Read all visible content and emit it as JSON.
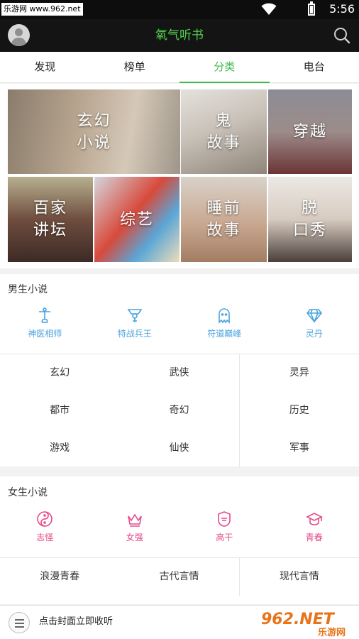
{
  "status_bar": {
    "watermark": "乐游网 www.962.net",
    "time": "5:56"
  },
  "app_bar": {
    "title": "氧气听书"
  },
  "tabs": [
    {
      "label": "发现"
    },
    {
      "label": "榜单"
    },
    {
      "label": "分类",
      "active": true
    },
    {
      "label": "电台"
    }
  ],
  "categories": [
    {
      "label": "玄幻\n小说"
    },
    {
      "label": "鬼\n故事"
    },
    {
      "label": "穿越"
    },
    {
      "label": "百家\n讲坛"
    },
    {
      "label": "综艺"
    },
    {
      "label": "睡前\n故事"
    },
    {
      "label": "脱\n口秀"
    }
  ],
  "male": {
    "title": "男生小说",
    "icon_items": [
      {
        "label": "神医相师",
        "icon": "statue-icon"
      },
      {
        "label": "特战兵王",
        "icon": "emblem-icon"
      },
      {
        "label": "符道巅峰",
        "icon": "ghost-icon"
      },
      {
        "label": "灵丹",
        "icon": "diamond-icon"
      }
    ],
    "rows": [
      [
        "玄幻",
        "武侠",
        "灵异"
      ],
      [
        "都市",
        "奇幻",
        "历史"
      ],
      [
        "游戏",
        "仙侠",
        "军事"
      ]
    ],
    "accent": "#4aa3df"
  },
  "female": {
    "title": "女生小说",
    "icon_items": [
      {
        "label": "志怪",
        "icon": "yin-yang-icon"
      },
      {
        "label": "女强",
        "icon": "crown-icon"
      },
      {
        "label": "高干",
        "icon": "badge-icon"
      },
      {
        "label": "青春",
        "icon": "graduation-cap-icon"
      }
    ],
    "rows": [
      [
        "浪漫青春",
        "古代言情",
        "现代言情"
      ]
    ],
    "accent": "#e64989"
  },
  "player": {
    "text": "点击封面立即收听"
  },
  "badge": {
    "number": "962",
    "suffix": ".NET",
    "sub": "乐游网"
  },
  "colors": {
    "brand_green": "#53d24c",
    "active_tab": "#3fb94a"
  }
}
